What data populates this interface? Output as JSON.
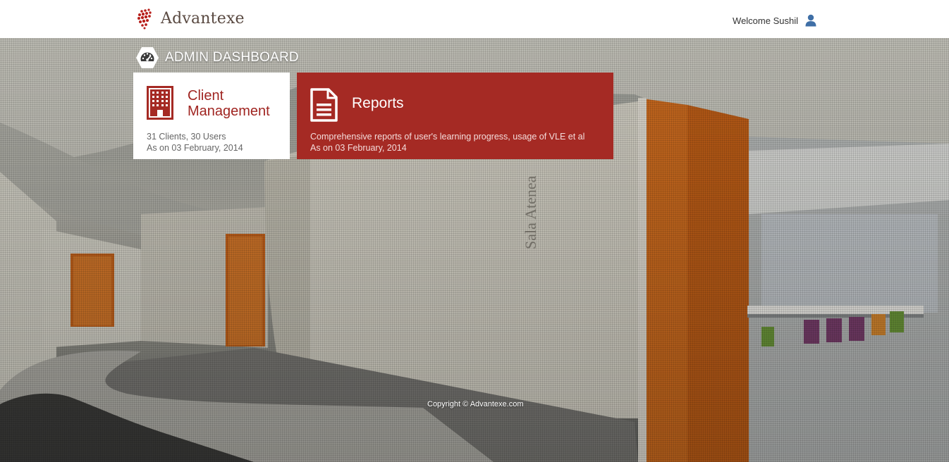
{
  "brand": {
    "name": "Advantexe",
    "accent_color": "#a52a24"
  },
  "header": {
    "welcome_text": "Welcome Sushil",
    "user_icon": "user-icon"
  },
  "dashboard": {
    "title": "ADMIN DASHBOARD",
    "title_icon": "speedometer-icon",
    "tiles": [
      {
        "title_line1": "Client",
        "title_line2": "Management",
        "line1": "31 Clients, 30 Users",
        "line2": "As on 03 February, 2014",
        "icon": "building-icon"
      },
      {
        "title": "Reports",
        "line1": "Comprehensive reports of user's learning progress, usage of VLE et al",
        "line2": "As on 03 February, 2014",
        "icon": "document-icon"
      }
    ]
  },
  "background": {
    "sign_text": "Sala Atenea"
  },
  "footer": {
    "copyright": "Copyright © Advantexe.com"
  }
}
